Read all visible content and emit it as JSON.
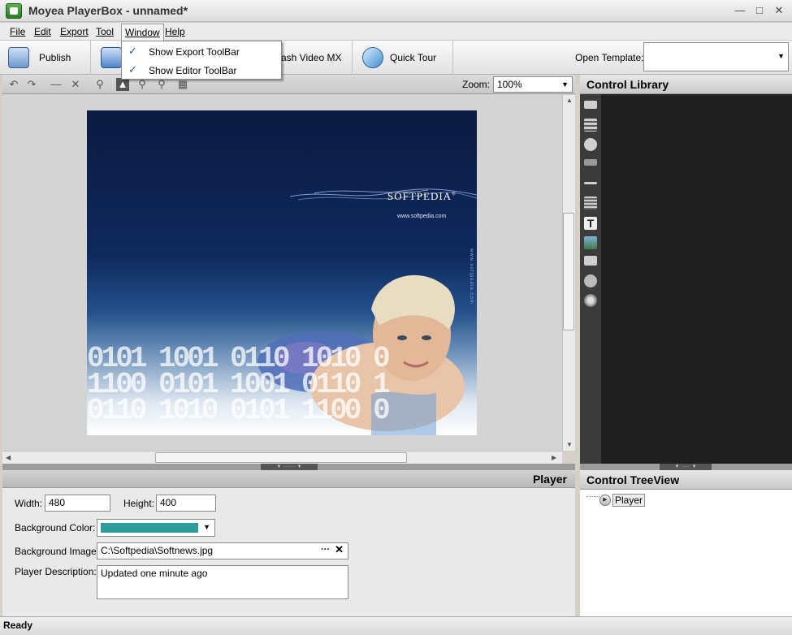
{
  "window": {
    "title": "Moyea PlayerBox - unnamed*",
    "controls": [
      "minimize-icon",
      "maximize-icon",
      "close-icon"
    ]
  },
  "menubar": {
    "items": [
      "File",
      "Edit",
      "Export",
      "Tool",
      "Window",
      "Help"
    ]
  },
  "window_menu": {
    "items": [
      {
        "label": "Show Export ToolBar",
        "checked": true
      },
      {
        "label": "Show Editor ToolBar",
        "checked": true
      }
    ]
  },
  "toolbar": {
    "publish_label": "Publish",
    "flashvideo_label": "ash Video MX",
    "quicktour_label": "Quick Tour",
    "open_template_label": "Open Template:",
    "open_template_value": ""
  },
  "editor_toolbar": {
    "icons": [
      "undo-icon",
      "redo-icon",
      "minus-icon",
      "delete-icon",
      "zoom-fit-icon",
      "select-icon",
      "zoom-out-icon",
      "zoom-in-icon",
      "grid-icon"
    ],
    "zoom_label": "Zoom:",
    "zoom_value": "100%"
  },
  "stage": {
    "logo_text": "SOFTPEDIA",
    "logo_mark": "®",
    "url_text": "www.softpedia.com",
    "binary_rows": [
      "0101 1001 0110 1010 0",
      "1100 0101 1001 0110 1",
      "0110 1010 0101 1100 0"
    ]
  },
  "properties": {
    "title": "Player",
    "width_label": "Width:",
    "width_value": "480",
    "height_label": "Height:",
    "height_value": "400",
    "bgcolor_label": "Background Color:",
    "bgcolor_value": "#2f9b9b",
    "bgimage_label": "Background Image:",
    "bgimage_value": "C:\\Softpedia\\Softnews.jpg",
    "description_label": "Player Description:",
    "description_value": "Updated one minute ago"
  },
  "control_library": {
    "title": "Control Library",
    "icons": [
      "button-icon",
      "filmstrip-icon",
      "circle-button-icon",
      "time-display-icon",
      "slider-icon",
      "list-icon",
      "text-icon",
      "image-icon",
      "link-icon",
      "counter-icon",
      "particles-icon"
    ]
  },
  "tree_view": {
    "title": "Control TreeView",
    "root_label": "Player"
  },
  "status": {
    "text": "Ready"
  },
  "colors": {
    "stage_top": "#0a1a40",
    "accent_teal": "#2f9b9b",
    "library_bg": "#1f1f1f"
  }
}
